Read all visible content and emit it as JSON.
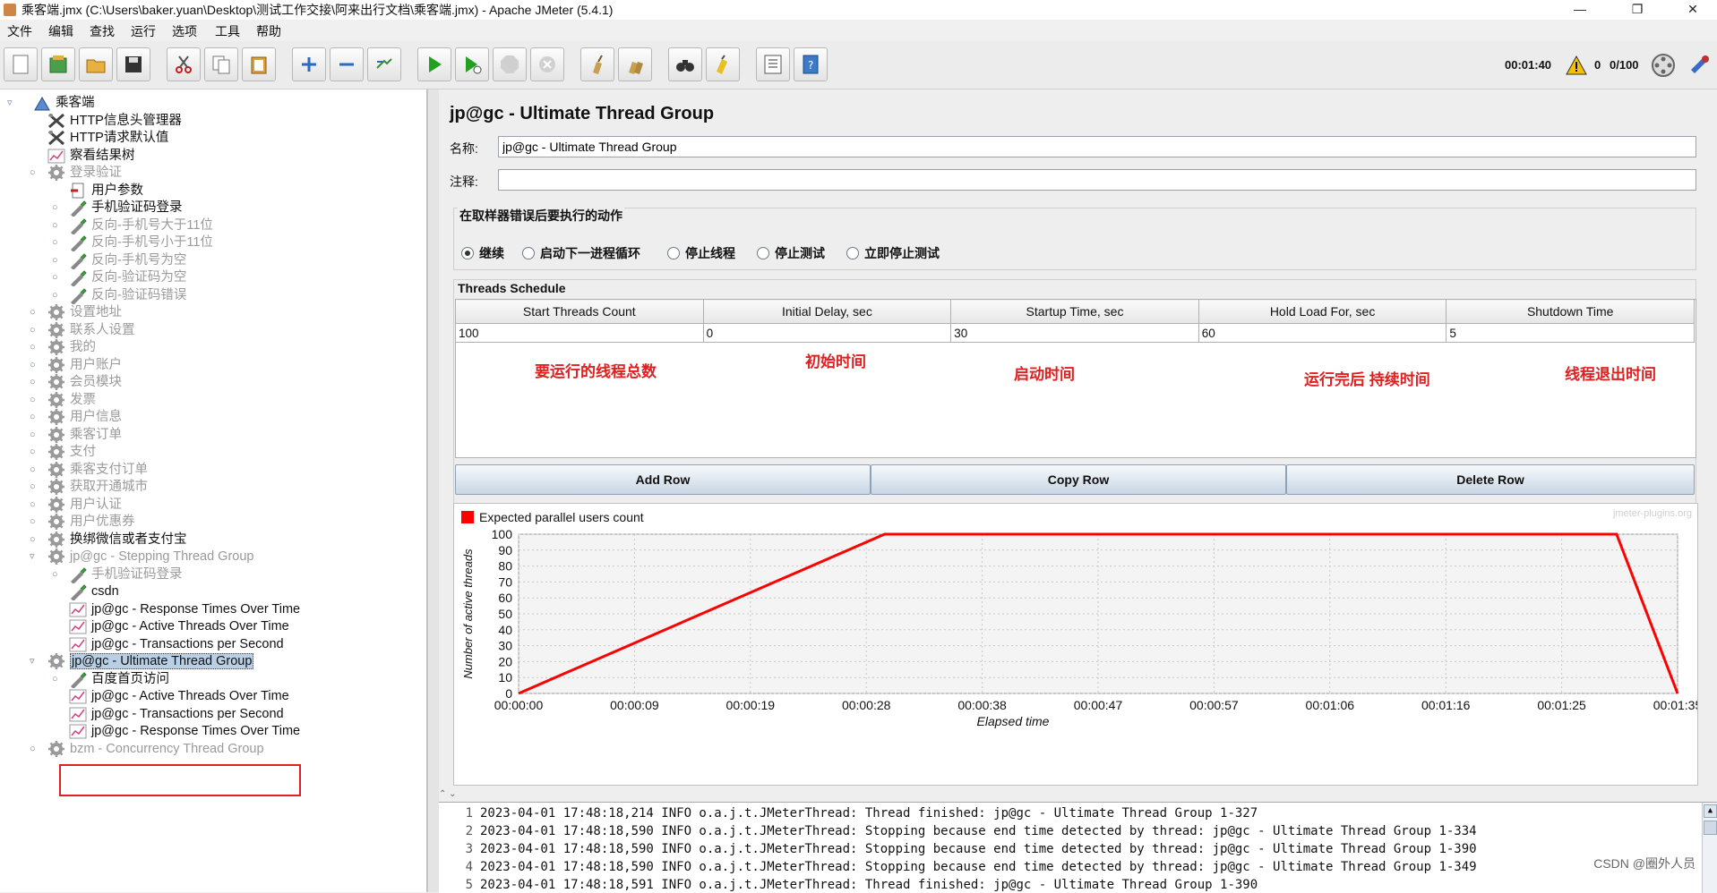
{
  "window": {
    "title": "乘客端.jmx (C:\\Users\\baker.yuan\\Desktop\\测试工作交接\\阿来出行文档\\乘客端.jmx) - Apache JMeter (5.4.1)",
    "minimize": "—",
    "maximize": "❐",
    "close": "✕"
  },
  "menu": [
    "文件",
    "编辑",
    "查找",
    "运行",
    "选项",
    "工具",
    "帮助"
  ],
  "toolbar": {
    "elapsed": "00:01:40",
    "warnings": "0",
    "threads": "0/100"
  },
  "tree": [
    {
      "label": "乘客端",
      "icon": "testplan-icon",
      "level": 0,
      "disabled": false,
      "handle": "▿"
    },
    {
      "label": "HTTP信息头管理器",
      "icon": "tools-icon",
      "level": 1,
      "disabled": false
    },
    {
      "label": "HTTP请求默认值",
      "icon": "tools-icon",
      "level": 1,
      "disabled": false
    },
    {
      "label": "察看结果树",
      "icon": "graph-icon",
      "level": 1,
      "disabled": false
    },
    {
      "label": "登录验证",
      "icon": "gear-icon",
      "level": 1,
      "disabled": true,
      "handle": "○"
    },
    {
      "label": "用户参数",
      "icon": "params-icon",
      "level": 2,
      "disabled": false
    },
    {
      "label": "手机验证码登录",
      "icon": "pipette-icon",
      "level": 2,
      "disabled": false,
      "handle": "○"
    },
    {
      "label": "反向-手机号大于11位",
      "icon": "pipette-icon",
      "level": 2,
      "disabled": true,
      "handle": "○"
    },
    {
      "label": "反向-手机号小于11位",
      "icon": "pipette-icon",
      "level": 2,
      "disabled": true,
      "handle": "○"
    },
    {
      "label": "反向-手机号为空",
      "icon": "pipette-icon",
      "level": 2,
      "disabled": true,
      "handle": "○"
    },
    {
      "label": "反向-验证码为空",
      "icon": "pipette-icon",
      "level": 2,
      "disabled": true,
      "handle": "○"
    },
    {
      "label": "反向-验证码错误",
      "icon": "pipette-icon",
      "level": 2,
      "disabled": true,
      "handle": "○"
    },
    {
      "label": "设置地址",
      "icon": "gear-icon",
      "level": 1,
      "disabled": true,
      "handle": "○"
    },
    {
      "label": "联系人设置",
      "icon": "gear-icon",
      "level": 1,
      "disabled": true,
      "handle": "○"
    },
    {
      "label": "我的",
      "icon": "gear-icon",
      "level": 1,
      "disabled": true,
      "handle": "○"
    },
    {
      "label": "用户账户",
      "icon": "gear-icon",
      "level": 1,
      "disabled": true,
      "handle": "○"
    },
    {
      "label": "会员模块",
      "icon": "gear-icon",
      "level": 1,
      "disabled": true,
      "handle": "○"
    },
    {
      "label": "发票",
      "icon": "gear-icon",
      "level": 1,
      "disabled": true,
      "handle": "○"
    },
    {
      "label": "用户信息",
      "icon": "gear-icon",
      "level": 1,
      "disabled": true,
      "handle": "○"
    },
    {
      "label": "乘客订单",
      "icon": "gear-icon",
      "level": 1,
      "disabled": true,
      "handle": "○"
    },
    {
      "label": "支付",
      "icon": "gear-icon",
      "level": 1,
      "disabled": true,
      "handle": "○"
    },
    {
      "label": "乘客支付订单",
      "icon": "gear-icon",
      "level": 1,
      "disabled": true,
      "handle": "○"
    },
    {
      "label": "获取开通城市",
      "icon": "gear-icon",
      "level": 1,
      "disabled": true,
      "handle": "○"
    },
    {
      "label": "用户认证",
      "icon": "gear-icon",
      "level": 1,
      "disabled": true,
      "handle": "○"
    },
    {
      "label": "用户优惠券",
      "icon": "gear-icon",
      "level": 1,
      "disabled": true,
      "handle": "○"
    },
    {
      "label": "换绑微信或者支付宝",
      "icon": "gear-icon",
      "level": 1,
      "disabled": false,
      "handle": "○"
    },
    {
      "label": "jp@gc - Stepping Thread Group",
      "icon": "gear-icon",
      "level": 1,
      "disabled": true,
      "handle": "▿"
    },
    {
      "label": "手机验证码登录",
      "icon": "pipette-icon",
      "level": 2,
      "disabled": true,
      "handle": "○"
    },
    {
      "label": "csdn",
      "icon": "pipette-icon",
      "level": 2,
      "disabled": false
    },
    {
      "label": "jp@gc - Response Times Over Time",
      "icon": "graph-icon",
      "level": 2,
      "disabled": false
    },
    {
      "label": "jp@gc - Active Threads Over Time",
      "icon": "graph-icon",
      "level": 2,
      "disabled": false
    },
    {
      "label": "jp@gc - Transactions per Second",
      "icon": "graph-icon",
      "level": 2,
      "disabled": false
    },
    {
      "label": "jp@gc - Ultimate Thread Group",
      "icon": "gear-icon",
      "level": 1,
      "disabled": false,
      "selected": true,
      "handle": "▿"
    },
    {
      "label": "百度首页访问",
      "icon": "pipette-icon",
      "level": 2,
      "disabled": false,
      "handle": "○"
    },
    {
      "label": "jp@gc - Active Threads Over Time",
      "icon": "graph-icon",
      "level": 2,
      "disabled": false
    },
    {
      "label": "jp@gc - Transactions per Second",
      "icon": "graph-icon",
      "level": 2,
      "disabled": false
    },
    {
      "label": "jp@gc - Response Times Over Time",
      "icon": "graph-icon",
      "level": 2,
      "disabled": false
    },
    {
      "label": "bzm - Concurrency Thread Group",
      "icon": "gear-icon",
      "level": 1,
      "disabled": true,
      "handle": "○"
    }
  ],
  "panel": {
    "title": "jp@gc - Ultimate Thread Group",
    "name_label": "名称:",
    "name_value": "jp@gc - Ultimate Thread Group",
    "comment_label": "注释:",
    "comment_value": "",
    "error_action_title": "在取样器错误后要执行的动作",
    "error_actions": [
      {
        "label": "继续",
        "selected": true
      },
      {
        "label": "启动下一进程循环",
        "selected": false
      },
      {
        "label": "停止线程",
        "selected": false
      },
      {
        "label": "停止测试",
        "selected": false
      },
      {
        "label": "立即停止测试",
        "selected": false
      }
    ],
    "schedule_title": "Threads Schedule",
    "schedule_columns": [
      "Start Threads Count",
      "Initial Delay, sec",
      "Startup Time, sec",
      "Hold Load For, sec",
      "Shutdown Time"
    ],
    "schedule_rows": [
      [
        "100",
        "0",
        "30",
        "60",
        "5"
      ]
    ],
    "annotations": [
      "要运行的线程总数",
      "初始时间",
      "启动时间",
      "运行完后 持续时间",
      "线程退出时间"
    ],
    "buttons": [
      "Add Row",
      "Copy Row",
      "Delete Row"
    ],
    "watermark": "jmeter-plugins.org",
    "log_collapse": "⌃ ⌄"
  },
  "chart_data": {
    "type": "line",
    "legend": "Expected parallel users count",
    "xlabel": "Elapsed time",
    "ylabel": "Number of active threads",
    "x_ticks": [
      "00:00:00",
      "00:00:09",
      "00:00:19",
      "00:00:28",
      "00:00:38",
      "00:00:47",
      "00:00:57",
      "00:01:06",
      "00:01:16",
      "00:01:25",
      "00:01:35"
    ],
    "y_ticks": [
      "100",
      "90",
      "80",
      "70",
      "60",
      "50",
      "40",
      "30",
      "20",
      "10",
      "0"
    ],
    "ylim": [
      0,
      100
    ],
    "xlim_sec": [
      0,
      95
    ],
    "series": [
      {
        "name": "Expected parallel users count",
        "color": "#ff0000",
        "x_sec": [
          0,
          30,
          90,
          95
        ],
        "y": [
          0,
          100,
          100,
          0
        ]
      }
    ]
  },
  "log": [
    {
      "n": "1",
      "text": "2023-04-01 17:48:18,214 INFO o.a.j.t.JMeterThread: Thread finished: jp@gc - Ultimate Thread Group 1-327"
    },
    {
      "n": "2",
      "text": "2023-04-01 17:48:18,590 INFO o.a.j.t.JMeterThread: Stopping because end time detected by thread: jp@gc - Ultimate Thread Group 1-334"
    },
    {
      "n": "3",
      "text": "2023-04-01 17:48:18,590 INFO o.a.j.t.JMeterThread: Stopping because end time detected by thread: jp@gc - Ultimate Thread Group 1-390"
    },
    {
      "n": "4",
      "text": "2023-04-01 17:48:18,590 INFO o.a.j.t.JMeterThread: Stopping because end time detected by thread: jp@gc - Ultimate Thread Group 1-349"
    },
    {
      "n": "5",
      "text": "2023-04-01 17:48:18,591 INFO o.a.j.t.JMeterThread: Thread finished: jp@gc - Ultimate Thread Group 1-390"
    }
  ],
  "watermark": "CSDN @圈外人员"
}
